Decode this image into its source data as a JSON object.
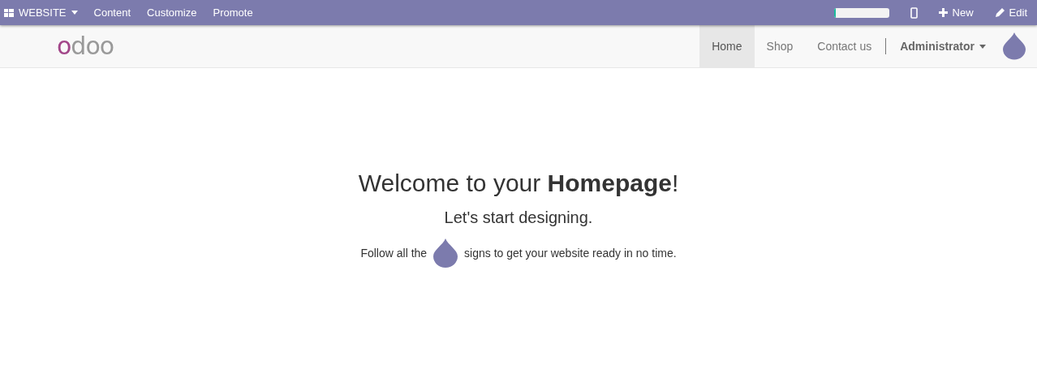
{
  "top_bar": {
    "app_menu": "WEBSITE",
    "menu": [
      "Content",
      "Customize",
      "Promote"
    ],
    "progress": {
      "level": 0.04
    },
    "new_button": "New",
    "edit_button": "Edit"
  },
  "header": {
    "logo": "odoo",
    "nav": [
      {
        "label": "Home",
        "selected": true
      },
      {
        "label": "Shop",
        "selected": false
      },
      {
        "label": "Contact us",
        "selected": false
      }
    ],
    "user_menu": "Administrator"
  },
  "hero": {
    "title": "Welcome to your **Homepage**!",
    "subtitle": "Let's start designing.",
    "hint_before": "Follow all the",
    "hint_after": "signs to get your website ready in no time."
  }
}
